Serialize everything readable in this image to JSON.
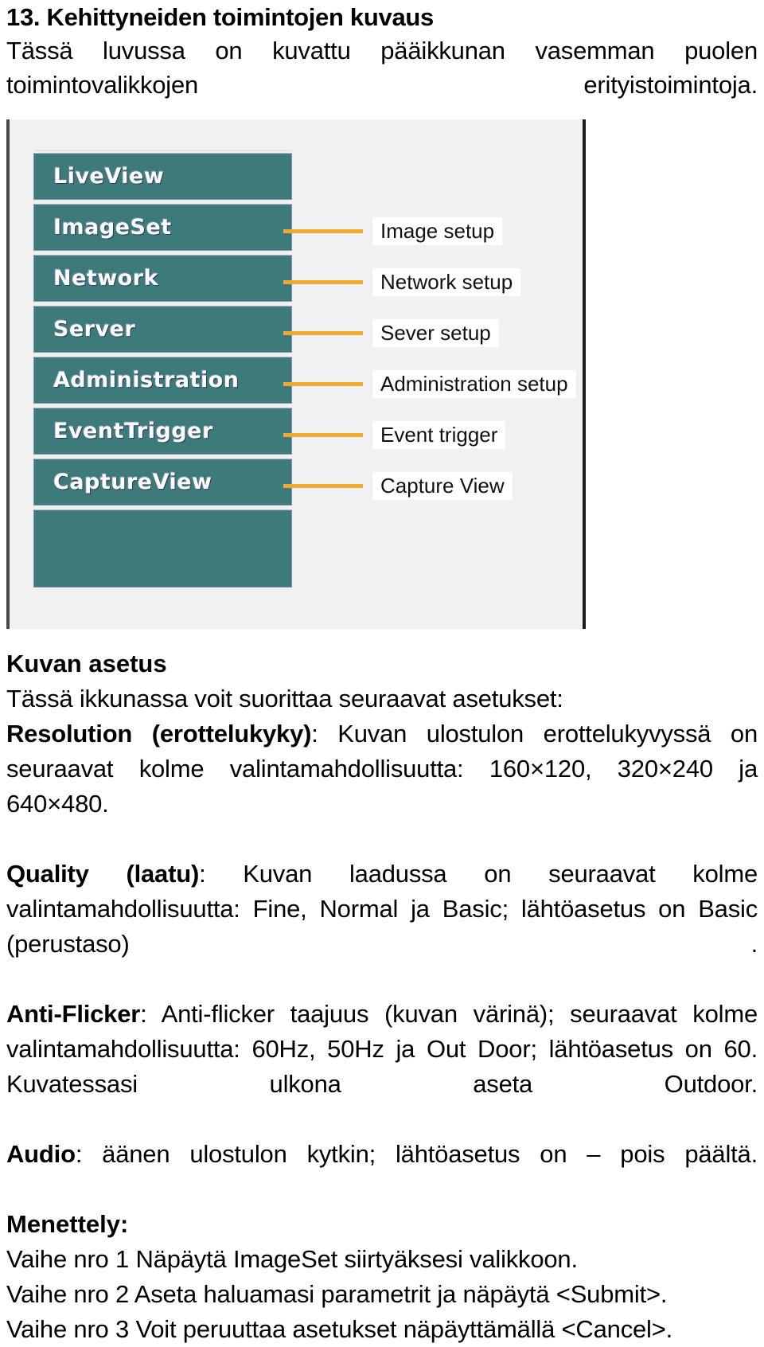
{
  "document": {
    "chapter_title": "13. Kehittyneiden toimintojen kuvaus",
    "intro": "Tässä luvussa on kuvattu pääikkunan vasemman puolen toimintovalikkojen erityistoimintoja."
  },
  "figure": {
    "menu_buttons": [
      {
        "label": "LiveView"
      },
      {
        "label": "ImageSet"
      },
      {
        "label": "Network"
      },
      {
        "label": "Server"
      },
      {
        "label": "Administration"
      },
      {
        "label": "EventTrigger"
      },
      {
        "label": "CaptureView"
      },
      {
        "label": ""
      }
    ],
    "callouts": [
      {
        "label": "Image setup"
      },
      {
        "label": "Network setup"
      },
      {
        "label": "Sever setup"
      },
      {
        "label": "Administration setup"
      },
      {
        "label": "Event trigger"
      },
      {
        "label": "Capture View"
      }
    ],
    "colors": {
      "button_fill": "#3d7b7b",
      "leader_line": "#f0a92f",
      "panel_background": "#f1f1f1"
    }
  },
  "sections": {
    "image_setup_heading": "Kuvan asetus",
    "image_setup_intro": "Tässä ikkunassa voit suorittaa seuraavat asetukset:",
    "resolution_label": "Resolution (erottelukyky)",
    "resolution_text": ": Kuvan ulostulon erottelukyvyssä on seuraavat kolme valintamahdollisuutta: 160×120, 320×240 ja 640×480.",
    "quality_label": "Quality (laatu)",
    "quality_text": ": Kuvan laadussa on seuraavat kolme valintamahdollisuutta: Fine, Normal ja Basic; lähtöasetus on Basic (perustaso) .",
    "antiflicker_label": "Anti-Flicker",
    "antiflicker_text": ": Anti-flicker taajuus (kuvan värinä); seuraavat kolme valintamahdollisuutta: 60Hz, 50Hz ja Out Door; lähtöasetus on 60. Kuvatessasi ulkona aseta Outdoor.",
    "audio_label": "Audio",
    "audio_text": ": äänen ulostulon kytkin; lähtöasetus on – pois päältä.",
    "procedure_heading": "Menettely:",
    "steps": [
      "Vaihe nro 1 Näpäytä ImageSet siirtyäksesi valikkoon.",
      "Vaihe nro 2 Aseta haluamasi parametrit ja näpäytä <Submit>.",
      "Vaihe nro 3 Voit peruuttaa asetukset näpäyttämällä <Cancel>."
    ]
  }
}
